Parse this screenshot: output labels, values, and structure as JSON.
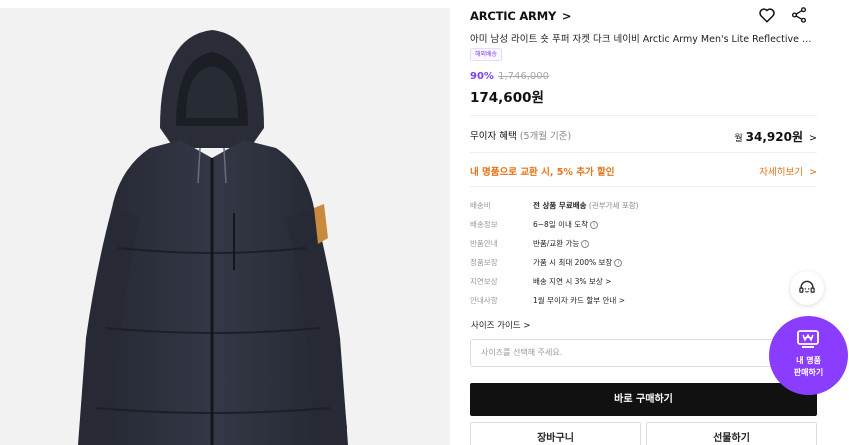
{
  "product": {
    "brand": "ARCTIC ARMY",
    "brand_chevron": ">",
    "title": "아미 남성 라이트 숏 푸퍼 자켓 다크 네이비 Arctic Army Men's Lite Reflective S...",
    "badge": "해외배송",
    "discount": "90%",
    "original_price": "1,746,000",
    "price": "174,600원"
  },
  "installment": {
    "label": "무이자 혜택",
    "sub": "(5개월 기준)",
    "prefix": "월",
    "amount": "34,920원",
    "chevron": ">"
  },
  "promo": {
    "text": "내 명품으로 교환 시, 5% 추가 할인",
    "link": "자세히보기",
    "chevron": ">"
  },
  "shipping_info": [
    {
      "label": "배송비",
      "value": "전 상품 무료배송",
      "sub": "(관부가세 포함)",
      "has_info": false,
      "link": false
    },
    {
      "label": "배송정보",
      "value": "6~8일 이내 도착",
      "sub": "",
      "has_info": true,
      "link": false
    },
    {
      "label": "반품안내",
      "value": "반품/교환 가능",
      "sub": "",
      "has_info": true,
      "link": false
    },
    {
      "label": "정품보장",
      "value": "가품 시 최대 200% 보장",
      "sub": "",
      "has_info": true,
      "link": false
    },
    {
      "label": "지연보상",
      "value": "배송 지연 시 3% 보상 >",
      "sub": "",
      "has_info": false,
      "link": true
    },
    {
      "label": "안내사항",
      "value": "1월 무이자 카드 할부 안내 >",
      "sub": "",
      "has_info": false,
      "link": true
    }
  ],
  "info_glyph": "i",
  "size_guide": "사이즈 가이드 >",
  "size_select_placeholder": "사이즈를 선택해 주세요.",
  "buttons": {
    "buy_now": "바로 구매하기",
    "cart": "장바구니",
    "gift": "선물하기"
  },
  "floating": {
    "cs_icon": "customer-support-icon",
    "sell_line1": "내 명품",
    "sell_line2": "판매하기",
    "sell_icon": "won-card-icon"
  },
  "colors": {
    "accent_purple": "#8b3dff",
    "discount_purple": "#7b3ff2",
    "promo_orange": "#e3741a",
    "buy_button": "#111111",
    "jacket_navy": "#2d3140"
  }
}
